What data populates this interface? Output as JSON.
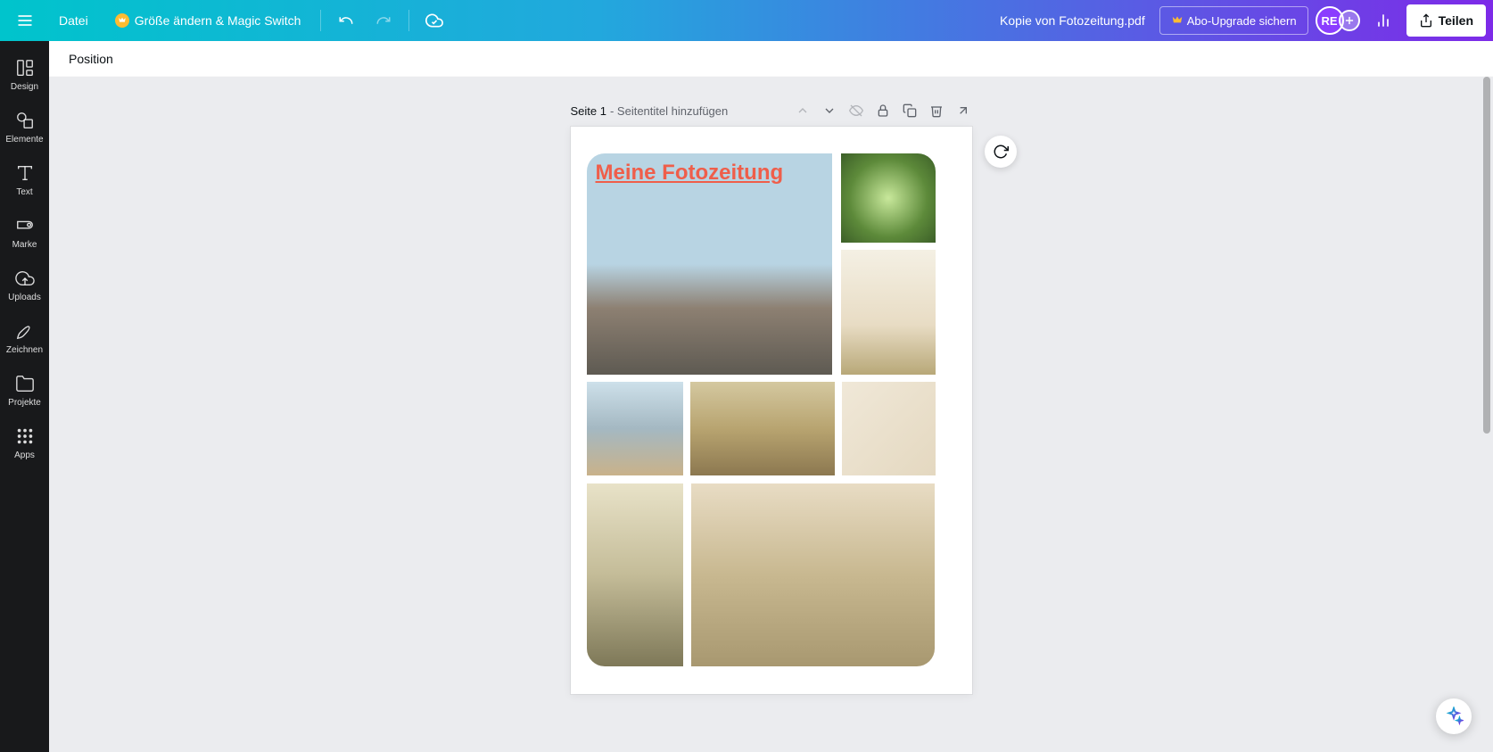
{
  "topbar": {
    "file_label": "Datei",
    "resize_label": "Größe ändern & Magic Switch",
    "doc_name": "Kopie von Fotozeitung.pdf",
    "upgrade_label": "Abo-Upgrade sichern",
    "share_label": "Teilen",
    "avatar_initials": "RE"
  },
  "sidebar": {
    "items": [
      {
        "label": "Design"
      },
      {
        "label": "Elemente"
      },
      {
        "label": "Text"
      },
      {
        "label": "Marke"
      },
      {
        "label": "Uploads"
      },
      {
        "label": "Zeichnen"
      },
      {
        "label": "Projekte"
      },
      {
        "label": "Apps"
      }
    ]
  },
  "contextbar": {
    "position_label": "Position"
  },
  "page": {
    "page_prefix": "Seite 1",
    "title_placeholder": " - Seitentitel hinzufügen",
    "collage_title": "Meine Fotozeitung"
  }
}
